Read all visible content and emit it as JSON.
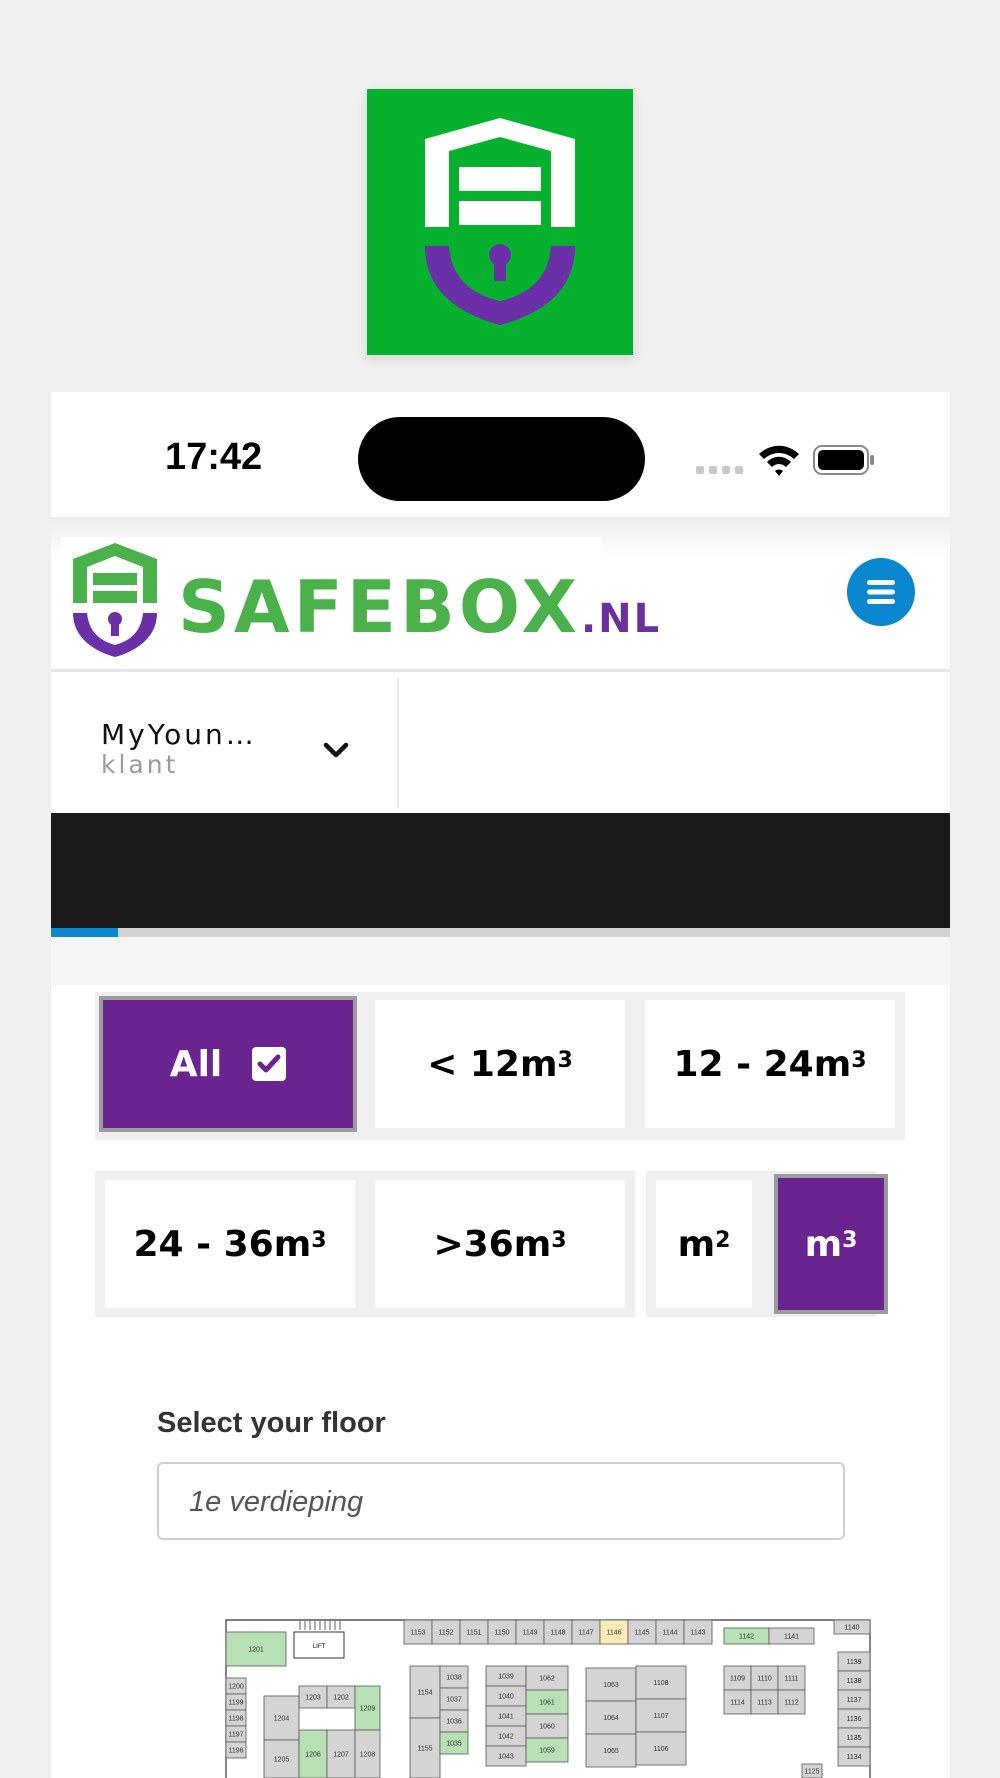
{
  "status_bar": {
    "time": "17:42"
  },
  "header": {
    "brand_name": "SAFEBOX",
    "brand_tld": ".NL"
  },
  "account": {
    "name": "MyYoun…",
    "role": "klant"
  },
  "progress": {
    "fraction": 0.075
  },
  "filters": {
    "all": {
      "label": "All",
      "selected": true
    },
    "under12": {
      "label": "< 12m",
      "sup": "3"
    },
    "range12_24": {
      "label": "12 - 24m",
      "sup": "3"
    },
    "range24_36": {
      "label": "24 - 36m",
      "sup": "3"
    },
    "over36": {
      "label": ">36m",
      "sup": "3"
    },
    "unit_m2": {
      "label": "m",
      "sup": "2",
      "selected": false
    },
    "unit_m3": {
      "label": "m",
      "sup": "3",
      "selected": true
    }
  },
  "floor": {
    "label": "Select your floor",
    "value": "1e verdieping"
  },
  "floorplan": {
    "top_row": [
      "1153",
      "1152",
      "1151",
      "1150",
      "1149",
      "1148",
      "1147",
      "1146",
      "1145",
      "1144",
      "1143"
    ],
    "top_right": [
      "1142",
      "1141",
      "1140"
    ],
    "left_column": [
      "1201",
      "1200",
      "1199",
      "1198",
      "1197",
      "1196"
    ],
    "lift_label": "LIFT",
    "block_a": [
      "1203",
      "1202",
      "1204",
      "1209",
      "1205",
      "1206",
      "1207",
      "1208"
    ],
    "block_b": [
      "1154",
      "1155"
    ],
    "block_c": [
      "1038",
      "1037",
      "1036",
      "1035"
    ],
    "block_d": [
      "1039",
      "1040",
      "1041",
      "1042",
      "1043"
    ],
    "block_e": [
      "1062",
      "1061",
      "1060",
      "1059"
    ],
    "block_f": [
      "1063",
      "1064",
      "1065"
    ],
    "block_g": [
      "1108",
      "1107",
      "1106"
    ],
    "block_h": [
      "1109",
      "1110",
      "1111",
      "1114",
      "1113",
      "1112"
    ],
    "right_column": [
      "1139",
      "1138",
      "1137",
      "1136",
      "1135",
      "1134"
    ],
    "small": [
      "1125"
    ],
    "highlight_green": "#b7e1b5",
    "highlight_yellow": "#fbecb5"
  },
  "colors": {
    "accent_purple": "#6a2490",
    "brand_green": "#4bb14a",
    "button_blue": "#0a87cf",
    "icon_green": "#06b12d"
  },
  "icons": {
    "menu": "hamburger-icon",
    "chevron": "chevron-down-icon",
    "check": "checkbox-checked-icon",
    "wifi": "wifi-icon",
    "battery": "battery-icon"
  }
}
